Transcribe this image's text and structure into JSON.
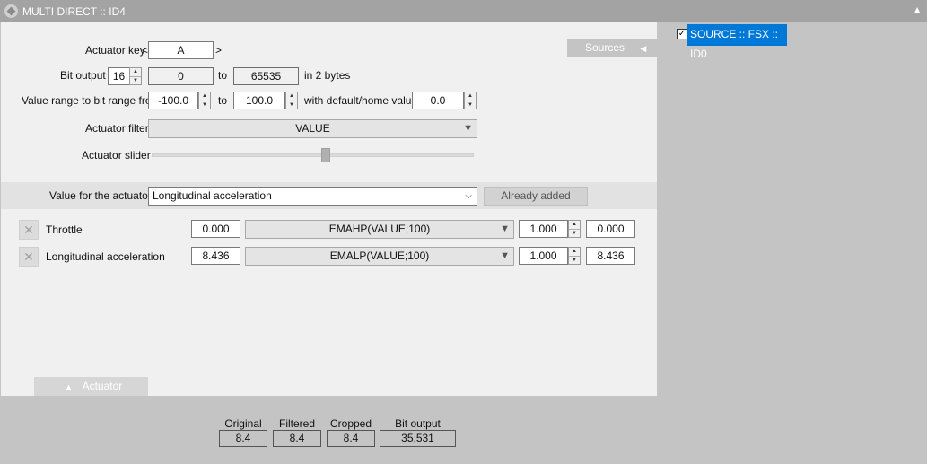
{
  "window": {
    "title": "MULTI DIRECT :: ID4",
    "collapse_icon": "triangle-up-icon"
  },
  "actuator_key": {
    "label": "Actuator key",
    "open": "<",
    "value": "A",
    "close": ">"
  },
  "bit_output": {
    "label": "Bit output",
    "bits": "16",
    "from": "0",
    "to_label": "to",
    "to": "65535",
    "suffix": "in 2 bytes"
  },
  "value_range": {
    "label": "Value range to bit range from",
    "from": "-100.0",
    "to_label": "to",
    "to": "100.0",
    "default_label": "with default/home value",
    "default": "0.0"
  },
  "actuator_filter": {
    "label": "Actuator filter",
    "value": "VALUE"
  },
  "actuator_slider": {
    "label": "Actuator slider",
    "position": 0.54
  },
  "sources_tab": {
    "label": "Sources",
    "icon": "triangle-left-icon"
  },
  "value_for_actuator": {
    "label": "Value for the actuator",
    "selected": "Longitudinal acceleration",
    "button": "Already added"
  },
  "rows": [
    {
      "name": "Throttle",
      "value": "0.000",
      "filter": "EMAHP(VALUE;100)",
      "factor": "1.000",
      "result": "0.000"
    },
    {
      "name": "Longitudinal acceleration",
      "value": "8.436",
      "filter": "EMALP(VALUE;100)",
      "factor": "1.000",
      "result": "8.436"
    }
  ],
  "actuator_tab": {
    "label": "Actuator",
    "icon": "triangle-up-icon"
  },
  "summary": {
    "original_label": "Original",
    "original": "8.4",
    "filtered_label": "Filtered",
    "filtered": "8.4",
    "cropped_label": "Cropped",
    "cropped": "8.4",
    "bit_output_label": "Bit output",
    "bit_output": "35,531"
  },
  "sources": [
    {
      "label": "SOURCE :: FSX :: ID0",
      "checked": true
    }
  ]
}
